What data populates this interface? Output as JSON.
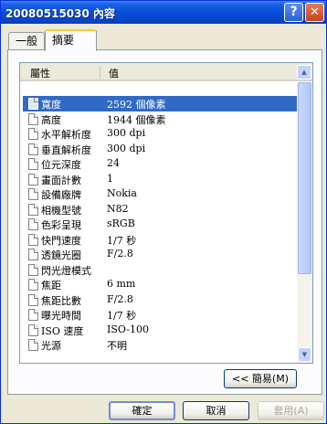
{
  "window": {
    "title": "20080515030 內容"
  },
  "titlebar": {
    "help_label": "?",
    "close_label": "✕"
  },
  "tabs": [
    {
      "label": "一般"
    },
    {
      "label": "摘要"
    }
  ],
  "list": {
    "headers": {
      "name": "屬性",
      "value": "值"
    },
    "rows": [
      {
        "name": "寬度",
        "value": "2592 個像素",
        "selected": true
      },
      {
        "name": "高度",
        "value": "1944 個像素"
      },
      {
        "name": "水平解析度",
        "value": "300 dpi"
      },
      {
        "name": "垂直解析度",
        "value": "300 dpi"
      },
      {
        "name": "位元深度",
        "value": "24"
      },
      {
        "name": "畫面計數",
        "value": "1"
      },
      {
        "name": "設備廠牌",
        "value": "Nokia"
      },
      {
        "name": "相機型號",
        "value": "N82"
      },
      {
        "name": "色彩呈現",
        "value": "sRGB"
      },
      {
        "name": "快門速度",
        "value": "1/7 秒"
      },
      {
        "name": "透鏡光圈",
        "value": "F/2.8"
      },
      {
        "name": "閃光燈模式",
        "value": ""
      },
      {
        "name": "焦距",
        "value": "6 mm"
      },
      {
        "name": "焦距比數",
        "value": "F/2.8"
      },
      {
        "name": "曝光時間",
        "value": "1/7 秒"
      },
      {
        "name": "ISO 速度",
        "value": "ISO-100"
      },
      {
        "name": "光源",
        "value": "不明"
      }
    ]
  },
  "buttons": {
    "simple": "<< 簡易(M)",
    "ok": "確定",
    "cancel": "取消",
    "apply": "套用(A)"
  }
}
